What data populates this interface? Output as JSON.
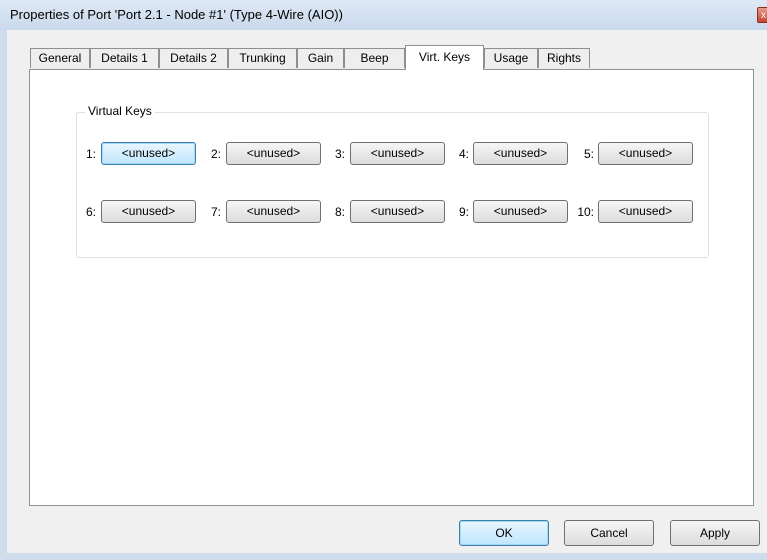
{
  "window": {
    "title": "Properties of Port 'Port 2.1 - Node #1' (Type 4-Wire (AIO))",
    "close_glyph": "x"
  },
  "tabs": [
    {
      "label": "General"
    },
    {
      "label": "Details 1"
    },
    {
      "label": "Details 2"
    },
    {
      "label": "Trunking"
    },
    {
      "label": "Gain"
    },
    {
      "label": "Beep"
    },
    {
      "label": "Virt. Keys",
      "active": true
    },
    {
      "label": "Usage"
    },
    {
      "label": "Rights"
    }
  ],
  "virtual_keys": {
    "group_title": "Virtual Keys",
    "keys": [
      {
        "num": "1:",
        "value": "<unused>"
      },
      {
        "num": "2:",
        "value": "<unused>"
      },
      {
        "num": "3:",
        "value": "<unused>"
      },
      {
        "num": "4:",
        "value": "<unused>"
      },
      {
        "num": "5:",
        "value": "<unused>"
      },
      {
        "num": "6:",
        "value": "<unused>"
      },
      {
        "num": "7:",
        "value": "<unused>"
      },
      {
        "num": "8:",
        "value": "<unused>"
      },
      {
        "num": "9:",
        "value": "<unused>"
      },
      {
        "num": "10:",
        "value": "<unused>"
      }
    ]
  },
  "footer": {
    "ok": "OK",
    "cancel": "Cancel",
    "apply": "Apply"
  }
}
